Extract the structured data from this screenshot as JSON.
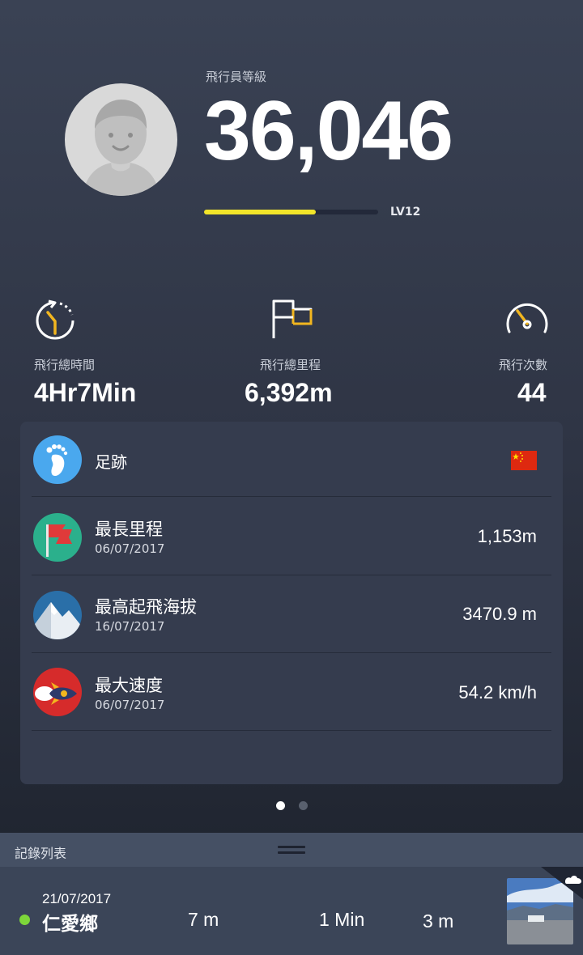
{
  "header": {
    "pilot_label": "飛行員等級",
    "score": "36,046",
    "level_label": "LV12",
    "level_progress": 0.64,
    "level_color": "#f2e52a"
  },
  "stats": [
    {
      "icon": "timer-icon",
      "label": "飛行總時間",
      "value": "4Hr7Min"
    },
    {
      "icon": "flag-icon",
      "label": "飛行總里程",
      "value": "6,392m"
    },
    {
      "icon": "speedometer-icon",
      "label": "飛行次數",
      "value": "44"
    }
  ],
  "records": {
    "footprint": {
      "icon": "footprint-icon",
      "title": "足跡",
      "flag_icon": "china-flag-icon"
    },
    "longest": {
      "icon": "red-flag-icon",
      "title": "最長里程",
      "date": "06/07/2017",
      "value": "1,153m"
    },
    "highest": {
      "icon": "mountain-icon",
      "title": "最高起飛海拔",
      "date": "16/07/2017",
      "value": "3470.9 m"
    },
    "fastest": {
      "icon": "rocket-icon",
      "title": "最大速度",
      "date": "06/07/2017",
      "value": "54.2 km/h"
    }
  },
  "pager": {
    "pages": 2,
    "active": 1
  },
  "list": {
    "title": "記錄列表",
    "items": [
      {
        "date": "21/07/2017",
        "place": "仁愛鄉",
        "distance": "7 m",
        "duration": "1 Min",
        "altitude": "3 m",
        "status_color": "#7dd63a",
        "thumbnail_icon": "landscape-thumbnail",
        "badge_icon": "cloud-upload-icon"
      }
    ]
  }
}
